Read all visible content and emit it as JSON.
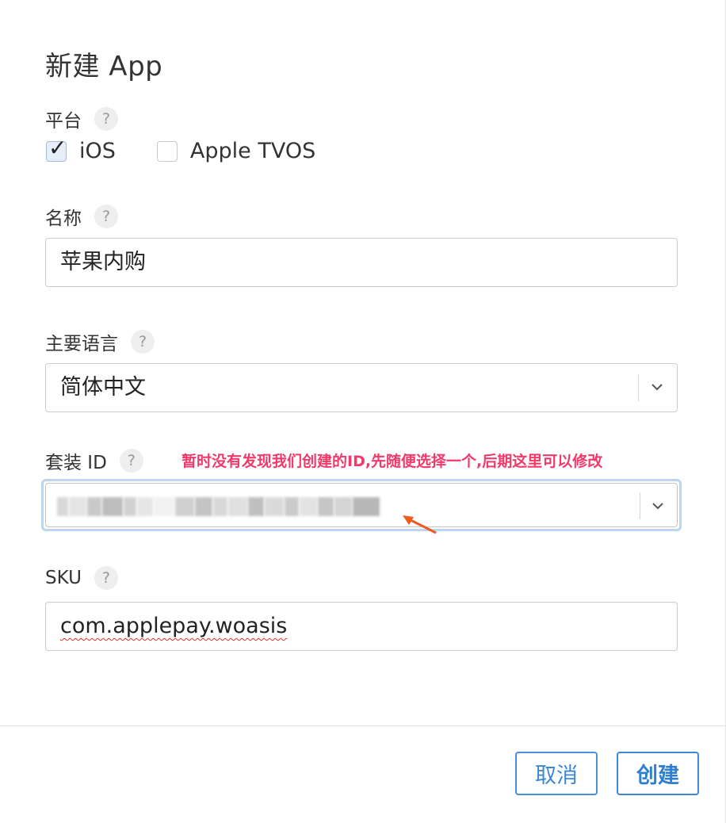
{
  "dialog": {
    "title": "新建 App",
    "help_glyph": "?"
  },
  "platform": {
    "label": "平台",
    "options": [
      {
        "label": "iOS",
        "checked": true
      },
      {
        "label": "Apple TVOS",
        "checked": false
      }
    ]
  },
  "name": {
    "label": "名称",
    "value": "苹果内购"
  },
  "language": {
    "label": "主要语言",
    "value": "简体中文"
  },
  "bundle_id": {
    "label": "套装 ID",
    "value_blurred": true,
    "annotation": "暂时没有发现我们创建的ID,先随便选择一个,后期这里可以修改"
  },
  "sku": {
    "label": "SKU",
    "value": "com.applepay.woasis"
  },
  "footer": {
    "cancel_label": "取消",
    "create_label": "创建"
  },
  "colors": {
    "accent": "#3b87d4",
    "annotation": "#f03a6a",
    "focus_ring": "#bcd6ef"
  },
  "icons": {
    "help": "question-icon",
    "checkmark": "checkmark-icon",
    "dropdown": "chevron-down-icon",
    "annotation_arrow": "arrow-icon"
  }
}
